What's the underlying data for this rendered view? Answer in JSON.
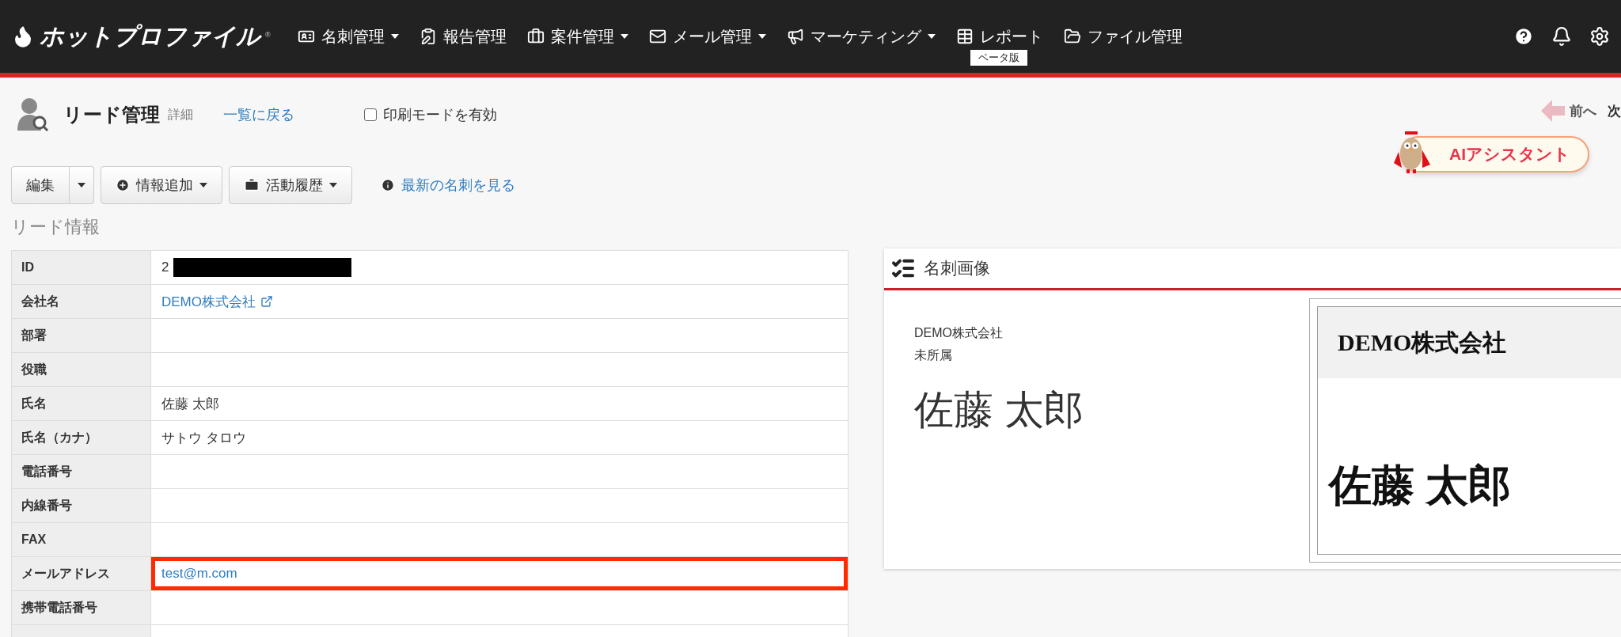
{
  "logo": {
    "text": "ホットプロファイル",
    "mark": "®"
  },
  "nav": [
    {
      "label": "名刺管理",
      "dropdown": true
    },
    {
      "label": "報告管理",
      "dropdown": false
    },
    {
      "label": "案件管理",
      "dropdown": true
    },
    {
      "label": "メール管理",
      "dropdown": true
    },
    {
      "label": "マーケティング",
      "dropdown": true
    },
    {
      "label": "レポート",
      "dropdown": false,
      "badge": "ベータ版"
    },
    {
      "label": "ファイル管理",
      "dropdown": false
    }
  ],
  "header": {
    "title": "リード管理",
    "subtitle": "詳細",
    "back_link": "一覧に戻る",
    "print_mode": {
      "label": "印刷モードを有効",
      "checked": false
    },
    "prev": "前へ",
    "next": "次"
  },
  "ai_button": "AIアシスタント",
  "toolbar": {
    "edit": "編集",
    "add_info": "情報追加",
    "history": "活動履歴",
    "latest_card_link": "最新の名刺を見る"
  },
  "section_title": "リード情報",
  "fields": [
    {
      "label": "ID",
      "value": "2",
      "kind": "redacted",
      "highlighted": false
    },
    {
      "label": "会社名",
      "value": "DEMO株式会社",
      "kind": "external_link",
      "highlighted": false
    },
    {
      "label": "部署",
      "kind": "text",
      "highlighted": false
    },
    {
      "label": "役職",
      "kind": "text",
      "highlighted": false
    },
    {
      "label": "氏名",
      "value": "佐藤 太郎",
      "kind": "text",
      "highlighted": false
    },
    {
      "label": "氏名（カナ）",
      "value": "サトウ タロウ",
      "kind": "text",
      "highlighted": false
    },
    {
      "label": "電話番号",
      "kind": "text",
      "highlighted": false
    },
    {
      "label": "内線番号",
      "kind": "text",
      "highlighted": false
    },
    {
      "label": "FAX",
      "kind": "text",
      "highlighted": false
    },
    {
      "label": "メールアドレス",
      "value": "test@m.com",
      "kind": "link",
      "highlighted": true
    },
    {
      "label": "携帯電話番号",
      "kind": "text",
      "highlighted": false
    }
  ],
  "card_panel": {
    "title": "名刺画像",
    "company": "DEMO株式会社",
    "department": "未所属",
    "name": "佐藤 太郎",
    "image": {
      "company": "DEMO株式会社",
      "name": "佐藤 太郎"
    }
  }
}
